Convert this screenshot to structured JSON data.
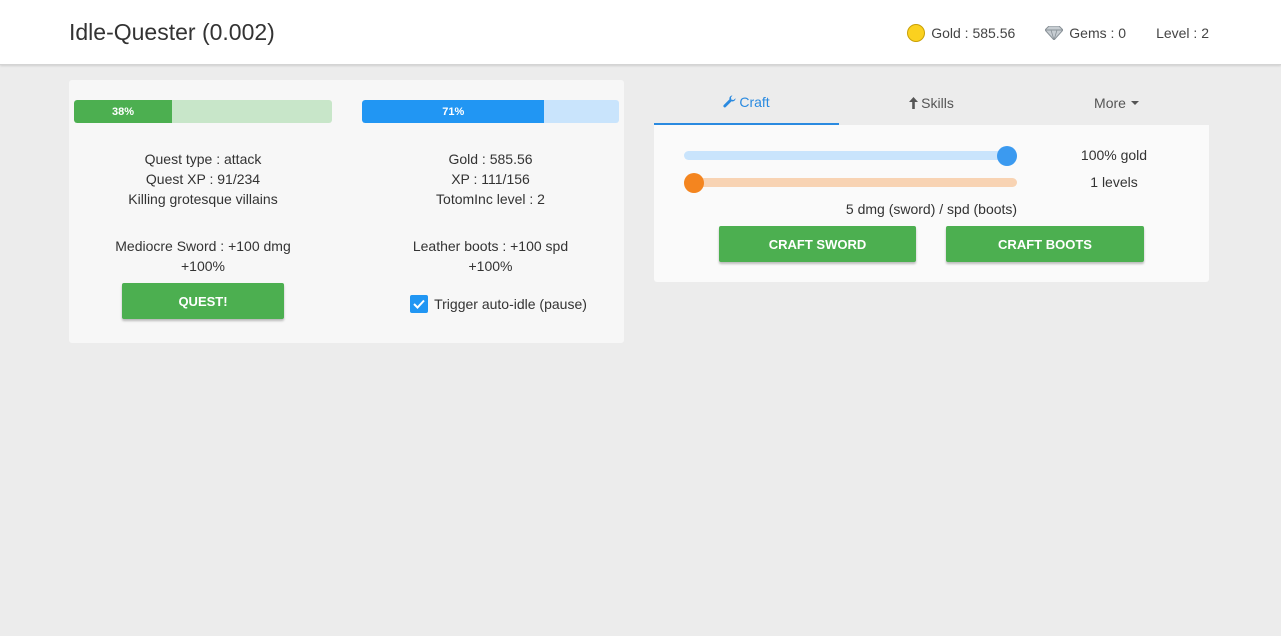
{
  "header": {
    "title": "Idle-Quester (0.002)",
    "gold": "Gold : 585.56",
    "gems": "Gems : 0",
    "level": "Level : 2"
  },
  "quest_column": {
    "progress_percent": 38,
    "progress_label": "38%",
    "quest_type": "Quest type : attack",
    "quest_xp": "Quest XP : 91/234",
    "description": "Killing grotesque villains",
    "sword": "Mediocre Sword : +100 dmg",
    "sword_bonus": "+100%",
    "quest_button": "QUEST!"
  },
  "stats_column": {
    "progress_percent": 71,
    "progress_label": "71%",
    "gold": "Gold : 585.56",
    "xp": "XP : 111/156",
    "totom_level": "TotomInc level : 2",
    "boots": "Leather boots : +100 spd",
    "boots_bonus": "+100%",
    "auto_idle_label": "Trigger auto-idle (pause)",
    "auto_idle_checked": true
  },
  "tabs": {
    "craft": "Craft",
    "skills": "Skills",
    "more": "More",
    "active": "craft"
  },
  "craft": {
    "gold_slider_percent": 100,
    "gold_label": "100% gold",
    "levels_slider_value": 1,
    "levels_label": "1 levels",
    "info": "5 dmg (sword) / spd (boots)",
    "craft_sword_button": "CRAFT SWORD",
    "craft_boots_button": "CRAFT BOOTS"
  },
  "colors": {
    "accent_blue": "#2196f3",
    "accent_green": "#4caf50",
    "accent_orange": "#f4851f",
    "tab_active": "#2a8ae0"
  }
}
